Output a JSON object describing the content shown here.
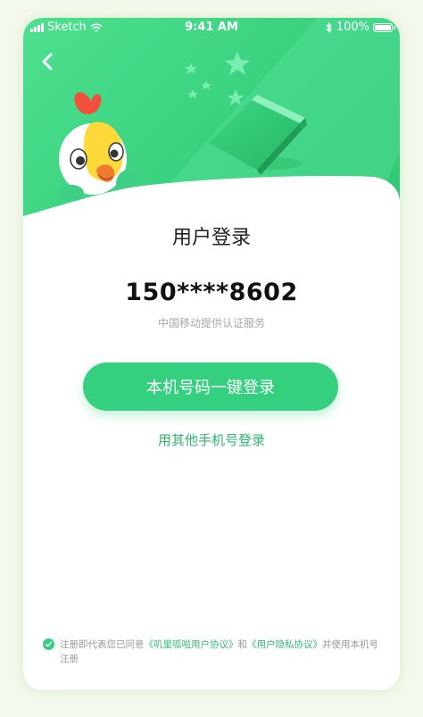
{
  "status_bar": {
    "carrier": "Sketch",
    "time": "9:41 AM",
    "battery": "100%"
  },
  "login": {
    "title": "用户登录",
    "phone_number": "150****8602",
    "provider": "中国移动提供认证服务",
    "one_tap_button": "本机号码一键登录",
    "other_login": "用其他手机号登录"
  },
  "agreement": {
    "prefix": "注册即代表您已同意",
    "link1": "《叽里呱啦用户协议》",
    "and": "和",
    "link2": "《用户隐私协议》",
    "suffix": "并使用本机号注册"
  },
  "colors": {
    "brand_green": "#34cf7f",
    "link_green": "#2fb56e"
  },
  "icons": {
    "back": "chevron-left-icon",
    "check": "check-circle-icon",
    "wifi": "wifi-icon",
    "bluetooth": "bluetooth-icon",
    "battery": "battery-icon",
    "signal": "signal-icon"
  }
}
